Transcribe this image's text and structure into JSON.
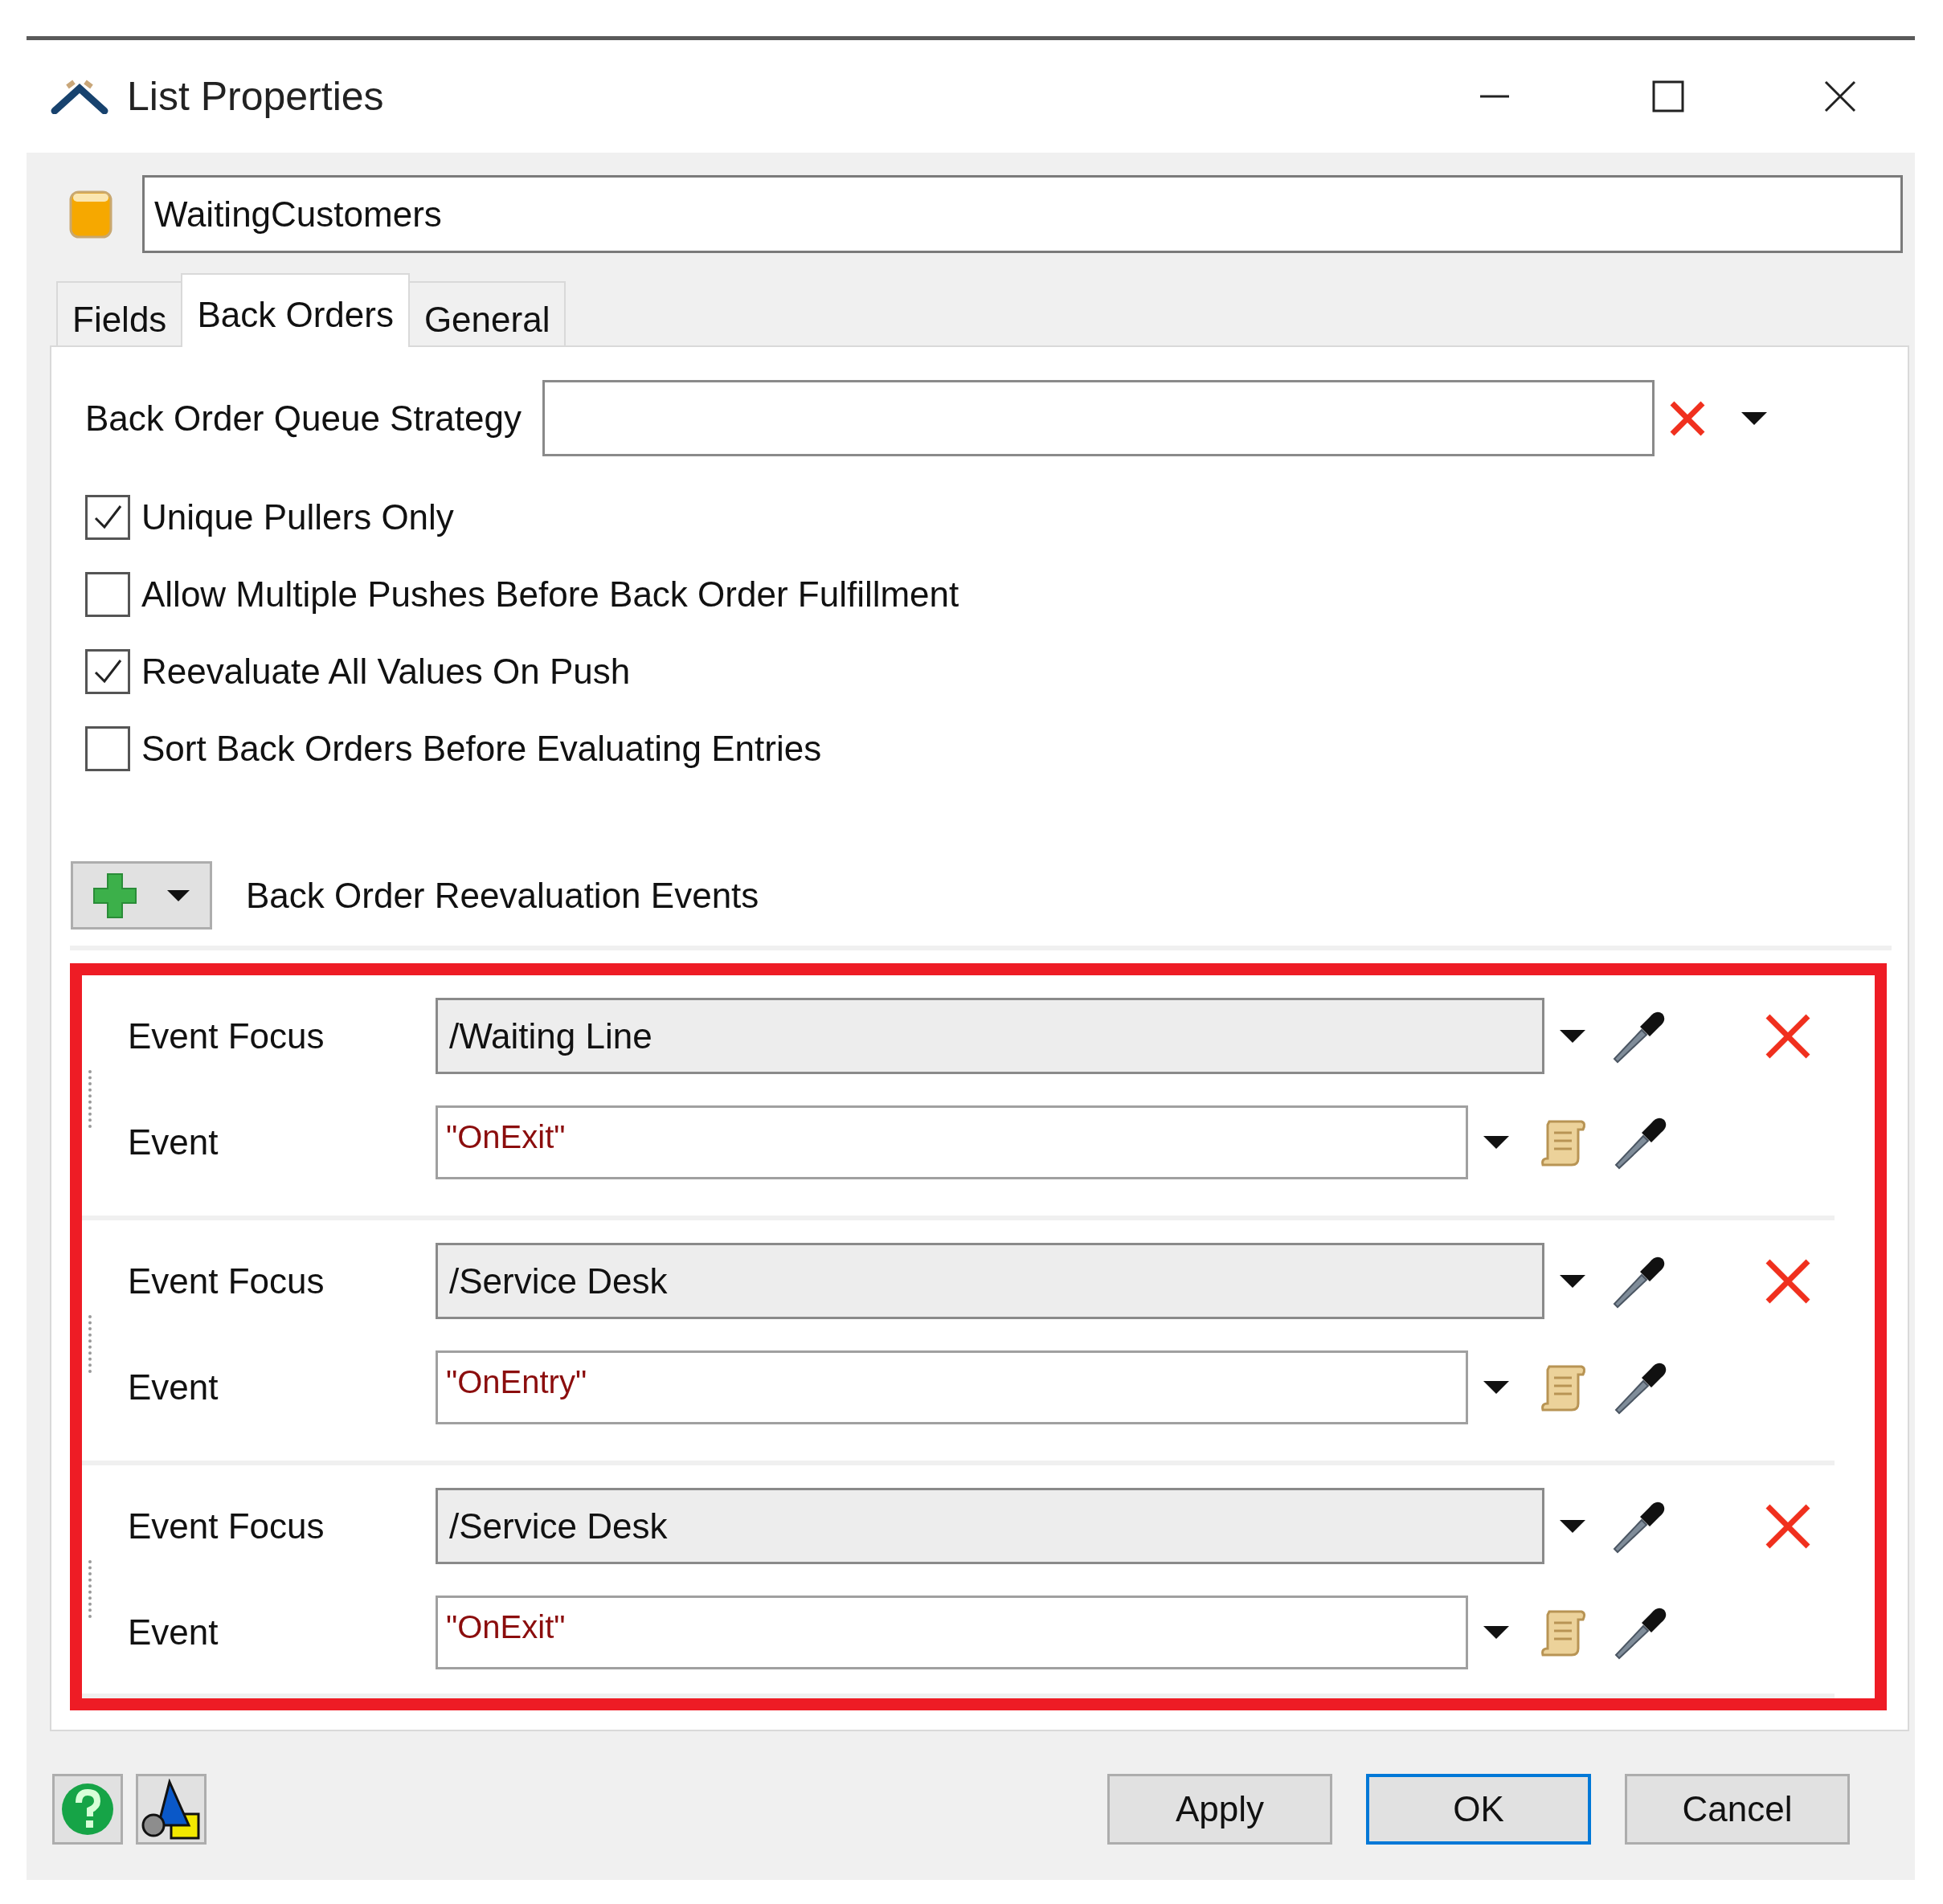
{
  "window": {
    "title": "List Properties"
  },
  "name_field": {
    "value": "WaitingCustomers"
  },
  "tabs": [
    {
      "label": "Fields",
      "selected": false
    },
    {
      "label": "Back Orders",
      "selected": true
    },
    {
      "label": "General",
      "selected": false
    }
  ],
  "queue_strategy": {
    "label": "Back Order Queue Strategy"
  },
  "options": [
    {
      "label": "Unique Pullers Only",
      "checked": true
    },
    {
      "label": "Allow Multiple Pushes Before Back Order Fulfillment",
      "checked": false
    },
    {
      "label": "Reevaluate All Values On Push",
      "checked": true
    },
    {
      "label": "Sort Back Orders Before Evaluating Entries",
      "checked": false
    }
  ],
  "events_section": {
    "label": "Back Order Reevaluation Events"
  },
  "events": [
    {
      "focus_label": "Event Focus",
      "focus": "/Waiting Line",
      "event_label": "Event",
      "event": "\"OnExit\""
    },
    {
      "focus_label": "Event Focus",
      "focus": "/Service Desk",
      "event_label": "Event",
      "event": "\"OnEntry\""
    },
    {
      "focus_label": "Event Focus",
      "focus": "/Service Desk",
      "event_label": "Event",
      "event": "\"OnExit\""
    }
  ],
  "buttons": [
    {
      "label": "Apply",
      "default": false
    },
    {
      "label": "OK",
      "default": true
    },
    {
      "label": "Cancel",
      "default": false
    }
  ]
}
